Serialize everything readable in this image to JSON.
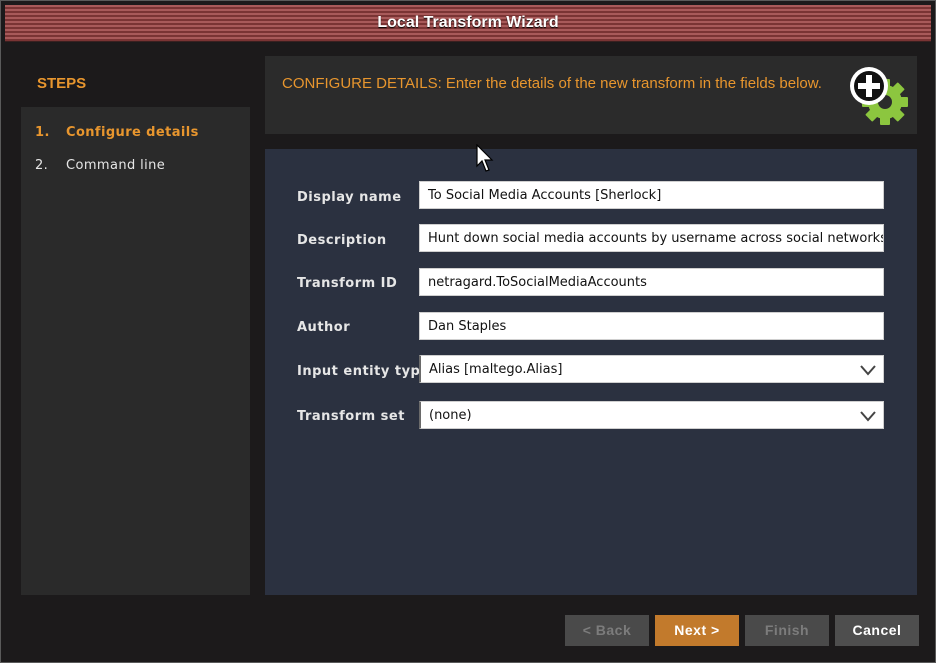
{
  "window": {
    "title": "Local Transform Wizard"
  },
  "steps": {
    "heading": "STEPS",
    "items": [
      {
        "num": "1.",
        "label": "Configure details"
      },
      {
        "num": "2.",
        "label": "Command line"
      }
    ]
  },
  "header": {
    "description": "CONFIGURE DETAILS: Enter the details of the new transform in the fields below.",
    "icon": "add-gear-icon"
  },
  "form": {
    "fields": [
      {
        "label": "Display name",
        "value": "To Social Media Accounts [Sherlock]"
      },
      {
        "label": "Description",
        "value": "Hunt down social media accounts by username across social networks"
      },
      {
        "label": "Transform ID",
        "value": "netragard.ToSocialMediaAccounts"
      },
      {
        "label": "Author",
        "value": "Dan Staples"
      },
      {
        "label": "Input entity type",
        "value": "Alias [maltego.Alias]"
      },
      {
        "label": "Transform set",
        "value": "(none)"
      }
    ]
  },
  "buttons": {
    "back": "< Back",
    "next": "Next >",
    "finish": "Finish",
    "cancel": "Cancel"
  },
  "colors": {
    "accent": "#e8962e",
    "icon_green": "#8cc63f",
    "next_button": "#c27a2c"
  }
}
